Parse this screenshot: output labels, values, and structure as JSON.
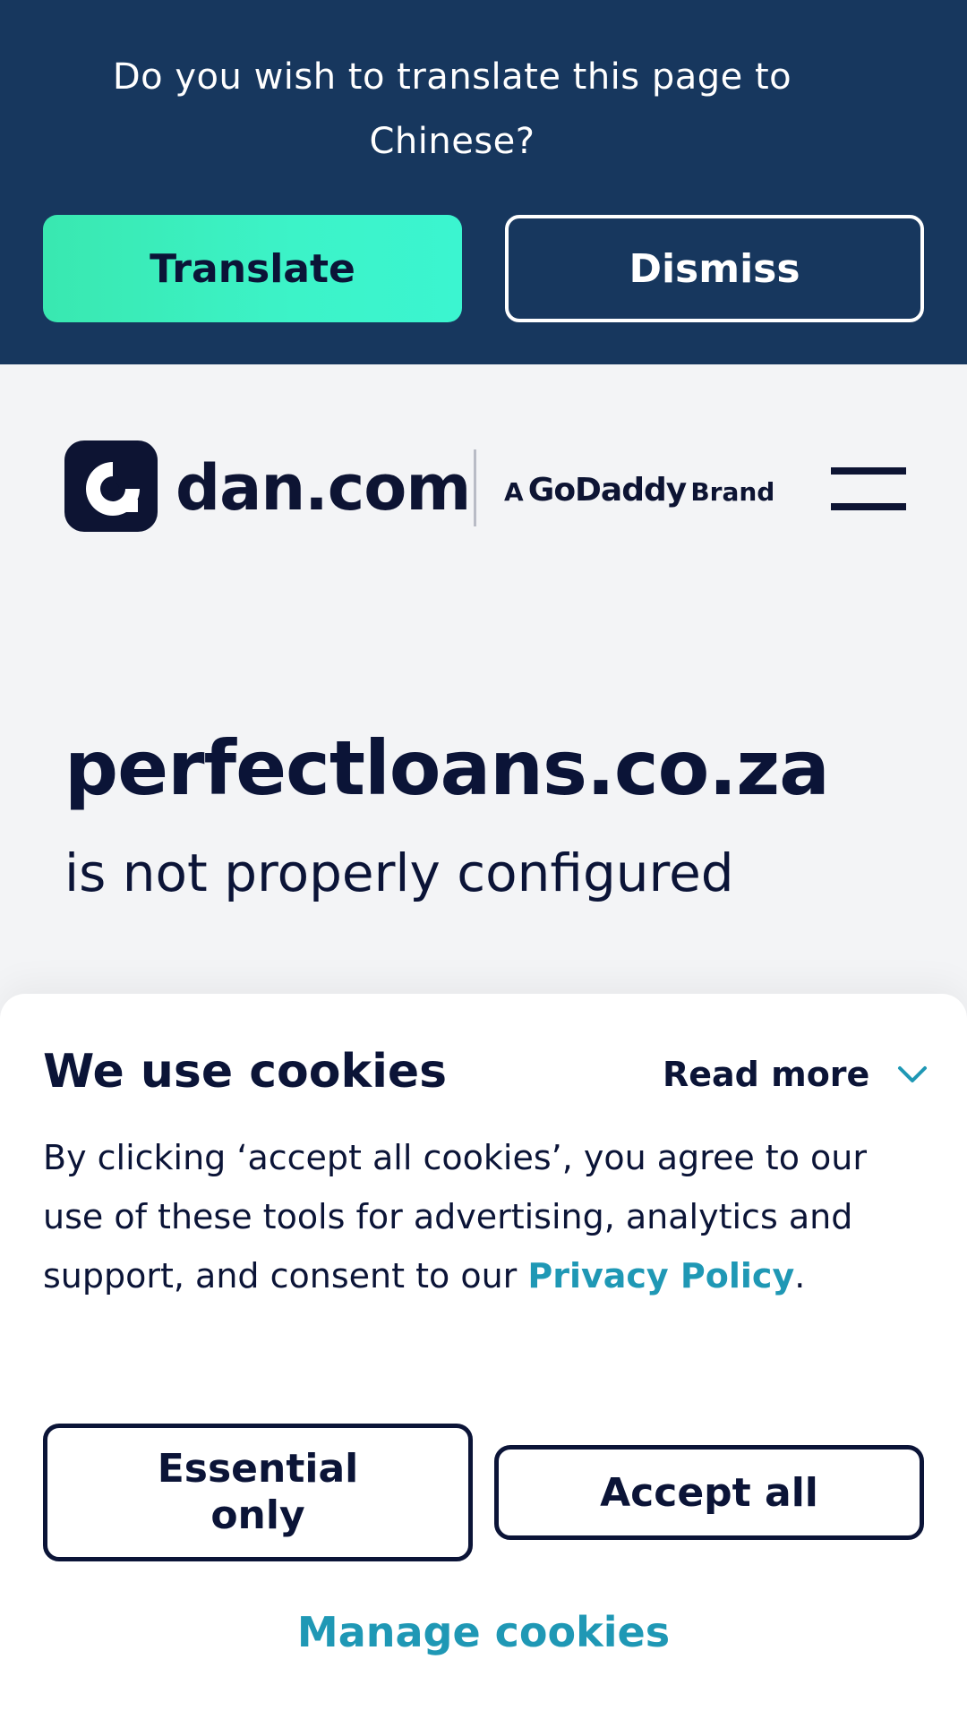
{
  "translate_banner": {
    "prompt": "Do you wish to translate this page to Chinese?",
    "translate_label": "Translate",
    "dismiss_label": "Dismiss"
  },
  "header": {
    "logo_text": "dan.com",
    "brand_prefix": "A",
    "brand_name": "GoDaddy",
    "brand_suffix": "Brand",
    "logo_icon": "dan-logo-icon",
    "menu_icon": "hamburger-menu-icon"
  },
  "main": {
    "domain": "perfectloans.co.za",
    "status": "is not properly configured"
  },
  "cookies": {
    "title": "We use cookies",
    "read_more_label": "Read more",
    "read_more_icon": "chevron-down-icon",
    "body_prefix": "By clicking ‘accept all cookies’, you agree to our use of these tools for advertising, analytics and support, and consent to our ",
    "privacy_link": "Privacy Policy",
    "body_suffix": ".",
    "essential_label": "Essential only",
    "accept_label": "Accept all",
    "manage_label": "Manage cookies"
  },
  "colors": {
    "banner_bg": "#17375e",
    "translate_btn": "#3cf3c8",
    "page_bg": "#f3f4f6",
    "navy": "#0b1437",
    "link_teal": "#1f98b5"
  }
}
